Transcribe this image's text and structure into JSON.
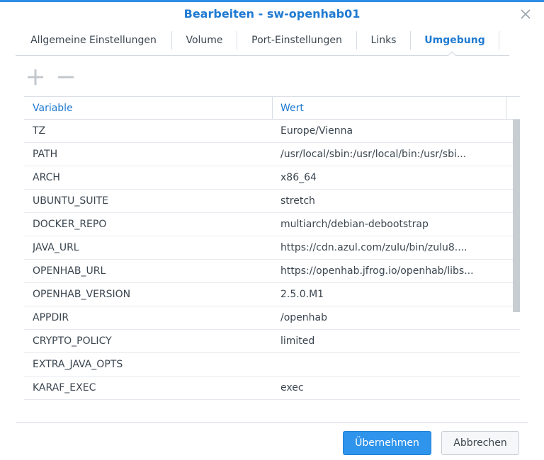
{
  "dialog": {
    "title": "Bearbeiten - sw-openhab01",
    "accent_color": "#1f7ad2",
    "close_icon": "close-icon"
  },
  "tabs": [
    {
      "label": "Allgemeine Einstellungen",
      "active": false
    },
    {
      "label": "Volume",
      "active": false
    },
    {
      "label": "Port-Einstellungen",
      "active": false
    },
    {
      "label": "Links",
      "active": false
    },
    {
      "label": "Umgebung",
      "active": true
    }
  ],
  "toolbar": {
    "add_icon": "plus-icon",
    "remove_icon": "minus-icon"
  },
  "table": {
    "columns": [
      "Variable",
      "Wert"
    ],
    "rows": [
      {
        "variable": "TZ",
        "value": "Europe/Vienna"
      },
      {
        "variable": "PATH",
        "value": "/usr/local/sbin:/usr/local/bin:/usr/sbi..."
      },
      {
        "variable": "ARCH",
        "value": "x86_64"
      },
      {
        "variable": "UBUNTU_SUITE",
        "value": "stretch"
      },
      {
        "variable": "DOCKER_REPO",
        "value": "multiarch/debian-debootstrap"
      },
      {
        "variable": "JAVA_URL",
        "value": "https://cdn.azul.com/zulu/bin/zulu8...."
      },
      {
        "variable": "OPENHAB_URL",
        "value": "https://openhab.jfrog.io/openhab/libs..."
      },
      {
        "variable": "OPENHAB_VERSION",
        "value": "2.5.0.M1"
      },
      {
        "variable": "APPDIR",
        "value": "/openhab"
      },
      {
        "variable": "CRYPTO_POLICY",
        "value": "limited"
      },
      {
        "variable": "EXTRA_JAVA_OPTS",
        "value": ""
      },
      {
        "variable": "KARAF_EXEC",
        "value": "exec"
      }
    ]
  },
  "footer": {
    "apply_label": "Übernehmen",
    "cancel_label": "Abbrechen"
  }
}
